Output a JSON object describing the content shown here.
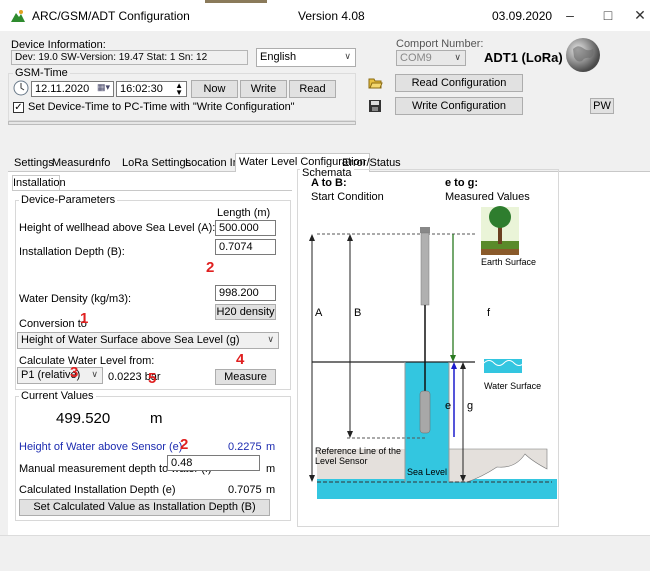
{
  "window": {
    "title": "ARC/GSM/ADT Configuration",
    "version": "Version 4.08",
    "date": "03.09.2020"
  },
  "device_info": {
    "label": "Device Information:",
    "value": "Dev: 19.0 SW-Version: 19.47 Stat: 1 Sn: 12",
    "language": "English"
  },
  "comport": {
    "label": "Comport Number:",
    "value": "COM9",
    "device_name": "ADT1 (LoRa)"
  },
  "gsm_time": {
    "label": "GSM-Time",
    "date": "12.11.2020",
    "time": "16:02:30",
    "now_label": "Now",
    "write_label": "Write",
    "read_label": "Read",
    "set_time_label": "Set Device-Time to PC-Time with \"Write Configuration\""
  },
  "config_buttons": {
    "read": "Read Configuration",
    "write": "Write Configuration",
    "pw": "PW"
  },
  "tabs": [
    "Settings",
    "Measure",
    "Info",
    "LoRa Settings",
    "Location Info",
    "Water Level Configuration",
    "Error/Status"
  ],
  "subtab": "Installation",
  "device_parameters": {
    "title": "Device-Parameters",
    "length_header": "Length (m)",
    "height_label": "Height of wellhead above Sea Level (A):",
    "height_value": "500.000",
    "depth_label": "Installation Depth (B):",
    "depth_value": "0.7074",
    "density_label": "Water Density (kg/m3):",
    "density_value": "998.200",
    "h2o_button": "H20 density",
    "conversion_label": "Conversion to",
    "conversion_value": "Height of Water Surface above Sea Level (g)",
    "calc_label": "Calculate Water Level from:",
    "calc_source": "P1 (relative)",
    "calc_reading": "0.0223 bar",
    "measure_button": "Measure"
  },
  "current_values": {
    "title": "Current Values",
    "big_value": "499.520",
    "big_unit": "m",
    "water_above_label": "Height of Water above Sensor (e)",
    "water_above_value": "0.2275",
    "water_above_unit": "m",
    "manual_label": "Manual measurement depth to water (f)",
    "manual_value": "0.48",
    "manual_unit": "m",
    "calc_depth_label": "Calculated Installation Depth (e)",
    "calc_depth_value": "0.7075",
    "calc_depth_unit": "m",
    "set_button": "Set Calculated Value as Installation Depth (B)"
  },
  "annotations": {
    "n1": "1",
    "n2a": "2",
    "n2b": "2",
    "n3": "3",
    "n4": "4",
    "n5": "5"
  },
  "schemata": {
    "title": "Schemata",
    "a_to_b": "A to B:",
    "start_condition": "Start Condition",
    "e_to_g": "e to g:",
    "measured_values": "Measured Values",
    "earth_surface": "Earth Surface",
    "water_surface": "Water Surface",
    "sea_level": "Sea Level",
    "ref_line_1": "Reference Line of the",
    "ref_line_2": "Level Sensor",
    "A": "A",
    "B": "B",
    "f": "f",
    "e": "e",
    "g": "g"
  },
  "colors": {
    "accent_red": "#e02020",
    "label_blue": "#1c2bb0",
    "water": "#33c6e0",
    "arrow_green": "#2a7a20",
    "arrow_blue": "#1c1ccc"
  }
}
